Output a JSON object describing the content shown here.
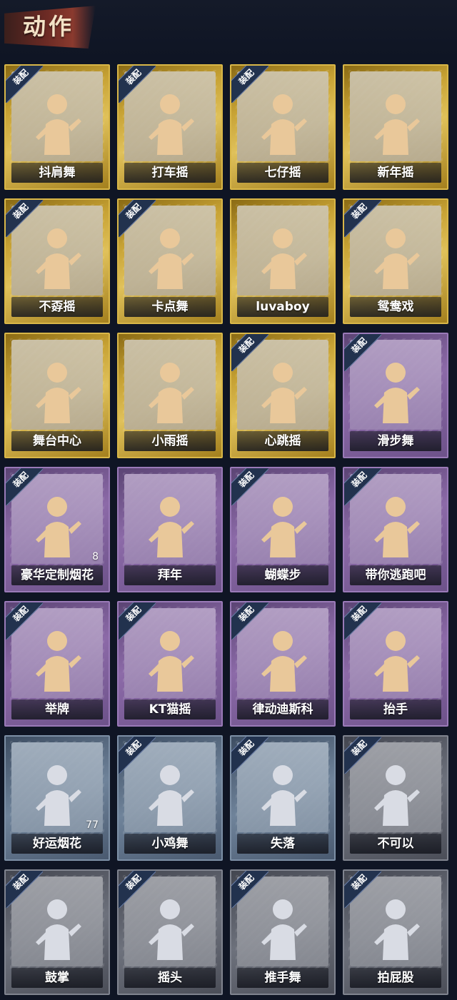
{
  "header": {
    "title": "动作"
  },
  "equip_tag": "装配",
  "rarity_colors": {
    "gold": "#c7a234",
    "purple": "#8c6aa8",
    "blue": "#6f839a",
    "gray": "#6d717c"
  },
  "emotes": [
    {
      "label": "抖肩舞",
      "rarity": "gold",
      "equipped": true,
      "count": ""
    },
    {
      "label": "打车摇",
      "rarity": "gold",
      "equipped": true,
      "count": ""
    },
    {
      "label": "七仔摇",
      "rarity": "gold",
      "equipped": true,
      "count": ""
    },
    {
      "label": "新年摇",
      "rarity": "gold",
      "equipped": false,
      "count": ""
    },
    {
      "label": "不孬摇",
      "rarity": "gold",
      "equipped": true,
      "count": ""
    },
    {
      "label": "卡点舞",
      "rarity": "gold",
      "equipped": true,
      "count": ""
    },
    {
      "label": "luvaboy",
      "rarity": "gold",
      "equipped": false,
      "count": ""
    },
    {
      "label": "鸳鸯戏",
      "rarity": "gold",
      "equipped": true,
      "count": ""
    },
    {
      "label": "舞台中心",
      "rarity": "gold",
      "equipped": false,
      "count": ""
    },
    {
      "label": "小雨摇",
      "rarity": "gold",
      "equipped": false,
      "count": ""
    },
    {
      "label": "心跳摇",
      "rarity": "gold",
      "equipped": true,
      "count": ""
    },
    {
      "label": "滑步舞",
      "rarity": "purple",
      "equipped": true,
      "count": ""
    },
    {
      "label": "豪华定制烟花",
      "rarity": "purple",
      "equipped": true,
      "count": "8"
    },
    {
      "label": "拜年",
      "rarity": "purple",
      "equipped": false,
      "count": ""
    },
    {
      "label": "蝴蝶步",
      "rarity": "purple",
      "equipped": true,
      "count": ""
    },
    {
      "label": "带你逃跑吧",
      "rarity": "purple",
      "equipped": true,
      "count": ""
    },
    {
      "label": "举牌",
      "rarity": "purple",
      "equipped": true,
      "count": ""
    },
    {
      "label": "KT猫摇",
      "rarity": "purple",
      "equipped": true,
      "count": ""
    },
    {
      "label": "律动迪斯科",
      "rarity": "purple",
      "equipped": true,
      "count": ""
    },
    {
      "label": "抬手",
      "rarity": "purple",
      "equipped": true,
      "count": ""
    },
    {
      "label": "好运烟花",
      "rarity": "blue",
      "equipped": false,
      "count": "77"
    },
    {
      "label": "小鸡舞",
      "rarity": "blue",
      "equipped": true,
      "count": ""
    },
    {
      "label": "失落",
      "rarity": "blue",
      "equipped": true,
      "count": ""
    },
    {
      "label": "不可以",
      "rarity": "gray",
      "equipped": true,
      "count": ""
    },
    {
      "label": "鼓掌",
      "rarity": "gray",
      "equipped": true,
      "count": ""
    },
    {
      "label": "摇头",
      "rarity": "gray",
      "equipped": true,
      "count": ""
    },
    {
      "label": "推手舞",
      "rarity": "gray",
      "equipped": true,
      "count": ""
    },
    {
      "label": "拍屁股",
      "rarity": "gray",
      "equipped": true,
      "count": ""
    }
  ]
}
